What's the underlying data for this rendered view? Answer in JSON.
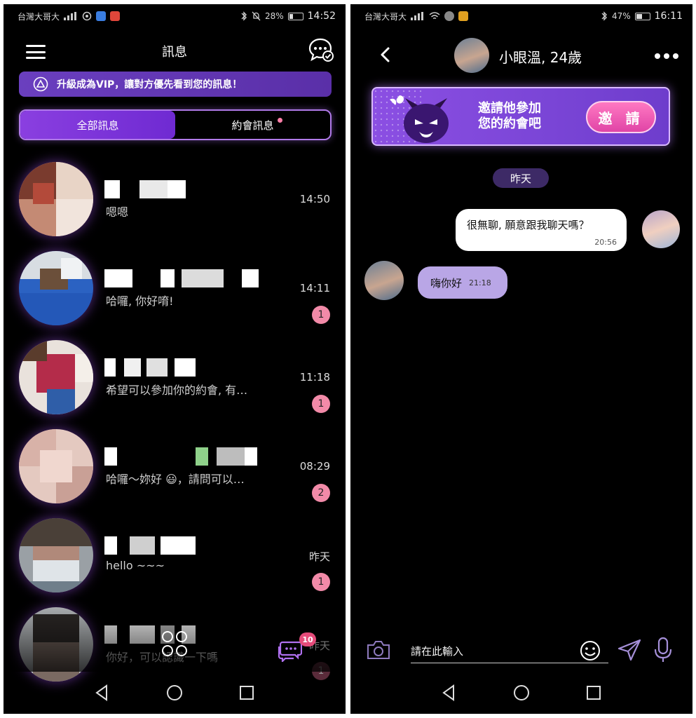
{
  "colors": {
    "accent_purple": "#7a3fe0",
    "badge_pink": "#f28aa8",
    "invite_button_pink": "#e044a6",
    "out_bubble": "#ffffff",
    "in_bubble": "#b9a6e6",
    "background": "#000000"
  },
  "left": {
    "status": {
      "carrier": "台灣大哥大",
      "battery": "28%",
      "battery_level": 0.28,
      "time": "14:52"
    },
    "header": {
      "menu_icon": "hamburger-icon",
      "title": "訊息",
      "action_icon": "chat-check-icon"
    },
    "vip_banner": {
      "icon": "vip-icon",
      "text": "升級成為VIP，讓對方優先看到您的訊息！"
    },
    "tabs": [
      {
        "label": "全部訊息",
        "active": true
      },
      {
        "label": "約會訊息",
        "active": false,
        "has_dot": true
      }
    ],
    "conversations": [
      {
        "preview": "嗯嗯",
        "time": "14:50",
        "unread": ""
      },
      {
        "preview": "哈囉, 你好唷!",
        "time": "14:11",
        "unread": "1"
      },
      {
        "preview": "希望可以參加你的約會, 有…",
        "time": "11:18",
        "unread": "1"
      },
      {
        "preview": "哈囉～妳好 😃，請問可以…",
        "time": "08:29",
        "unread": "2"
      },
      {
        "preview": "hello ~~~",
        "time": "昨天",
        "unread": "1"
      },
      {
        "preview": "你好，可以認識一下嗎",
        "time": "昨天",
        "unread": "1"
      }
    ],
    "floating": {
      "apps_icon": "apps-icon",
      "chat_icon": "chat-bubbles-icon",
      "chat_badge": "10"
    },
    "nav": {
      "back_icon": "back-triangle-icon",
      "home_icon": "home-circle-icon",
      "recents_icon": "recents-square-icon"
    }
  },
  "right": {
    "status": {
      "carrier": "台灣大哥大",
      "battery": "47%",
      "battery_level": 0.47,
      "time": "16:11"
    },
    "header": {
      "back_icon": "chevron-left-icon",
      "name": "小眼溫, 24歲",
      "more_icon": "more-dots-icon"
    },
    "invite": {
      "icon": "devil-mascot-icon",
      "line1": "邀請他參加",
      "line2": "您的約會吧",
      "button": "邀 請"
    },
    "date_divider": "昨天",
    "messages": [
      {
        "direction": "out",
        "text": "很無聊, 願意跟我聊天嗎？",
        "time": "20:56"
      },
      {
        "direction": "in",
        "text": "嗨你好",
        "time": "21:18"
      }
    ],
    "composer": {
      "camera_icon": "camera-icon",
      "placeholder": "請在此輸入",
      "emoji_icon": "smiley-icon",
      "send_icon": "send-icon",
      "mic_icon": "microphone-icon"
    },
    "nav": {
      "back_icon": "back-triangle-icon",
      "home_icon": "home-circle-icon",
      "recents_icon": "recents-square-icon"
    }
  }
}
